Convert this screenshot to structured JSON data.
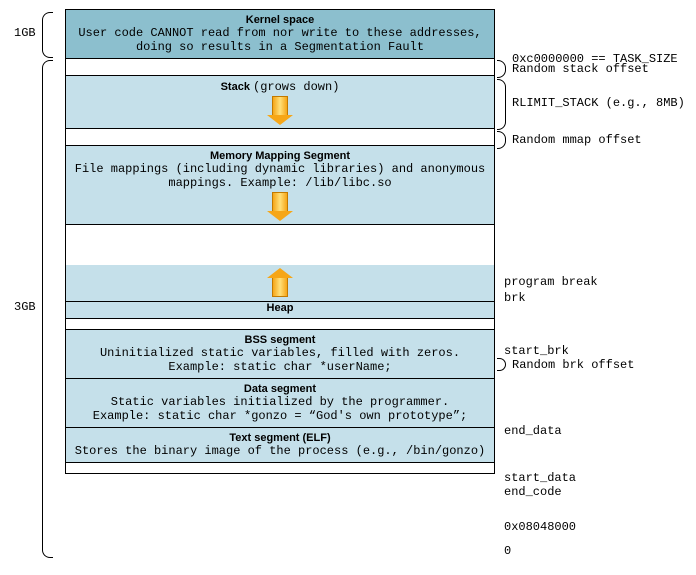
{
  "left": {
    "kernel_size": "1GB",
    "user_size": "3GB"
  },
  "segments": {
    "kernel": {
      "title": "Kernel space",
      "desc": "User code CANNOT read from nor write to these addresses, doing so results in a Segmentation Fault"
    },
    "stack": {
      "title": "Stack",
      "note": "(grows down)"
    },
    "mmap": {
      "title": "Memory Mapping Segment",
      "desc": "File mappings (including dynamic libraries) and anonymous mappings. Example: /lib/libc.so"
    },
    "heap": {
      "title": "Heap"
    },
    "bss": {
      "title": "BSS segment",
      "desc1": "Uninitialized static variables, filled with zeros.",
      "desc2": "Example: static char *userName;"
    },
    "data": {
      "title": "Data segment",
      "desc1": "Static variables initialized by the programmer.",
      "desc2": "Example: static char *gonzo = “God's own prototype”;"
    },
    "text": {
      "title": "Text segment (ELF)",
      "desc": "Stores the binary image of the process (e.g., /bin/gonzo)"
    }
  },
  "right": {
    "task_size": "0xc0000000 == TASK_SIZE",
    "random_stack": "Random stack offset",
    "rlimit": "RLIMIT_STACK (e.g., 8MB)",
    "random_mmap": "Random mmap offset",
    "program_break": "program break",
    "brk": "brk",
    "start_brk": "start_brk",
    "random_brk": "Random brk offset",
    "end_data": "end_data",
    "start_data": "start_data",
    "end_code": "end_code",
    "text_start": "0x08048000",
    "zero": "0"
  }
}
